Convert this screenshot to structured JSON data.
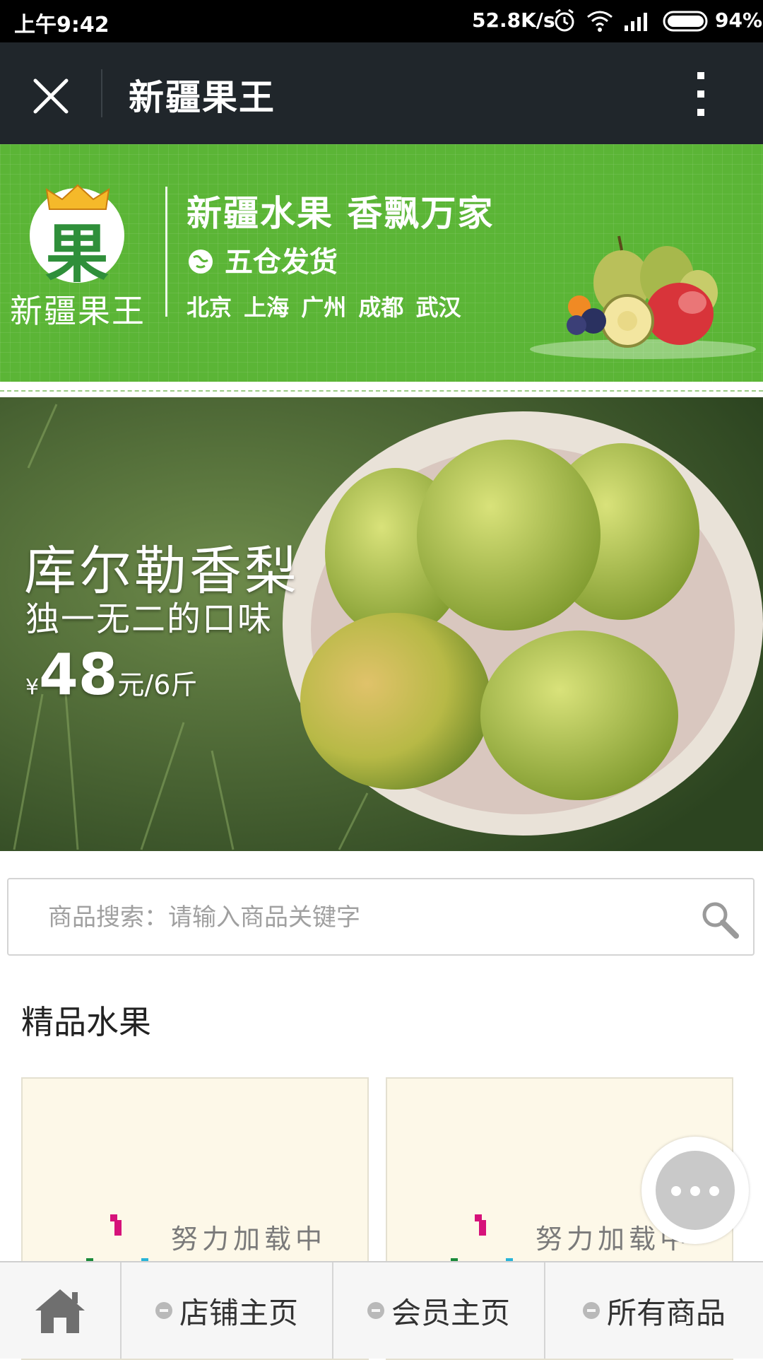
{
  "status_bar": {
    "time": "上午9:42",
    "net_speed": "52.8K/s",
    "battery": "94%"
  },
  "app_bar": {
    "title": "新疆果王"
  },
  "banner": {
    "logo_char": "果",
    "logo_text": "新疆果王",
    "slogan": "新疆水果 香飘万家",
    "shipping": "五仓发货",
    "cities": "北京 上海 广州 成都 武汉"
  },
  "hero": {
    "title": "库尔勒香梨",
    "subtitle": "独一无二的口味",
    "currency": "¥",
    "price": "48",
    "unit": "元/6斤"
  },
  "search": {
    "placeholder": "商品搜索：请输入商品关键字"
  },
  "section": {
    "title": "精品水果"
  },
  "cards": [
    {
      "loading_text": "努力加载中"
    },
    {
      "loading_text": "努力加载中"
    }
  ],
  "bottom_nav": {
    "items": [
      {
        "label": "店铺主页"
      },
      {
        "label": "会员主页"
      },
      {
        "label": "所有商品"
      }
    ]
  },
  "colors": {
    "banner_green": "#5bb536",
    "app_bar": "#20262b",
    "card_bg": "#fdf8e8"
  }
}
